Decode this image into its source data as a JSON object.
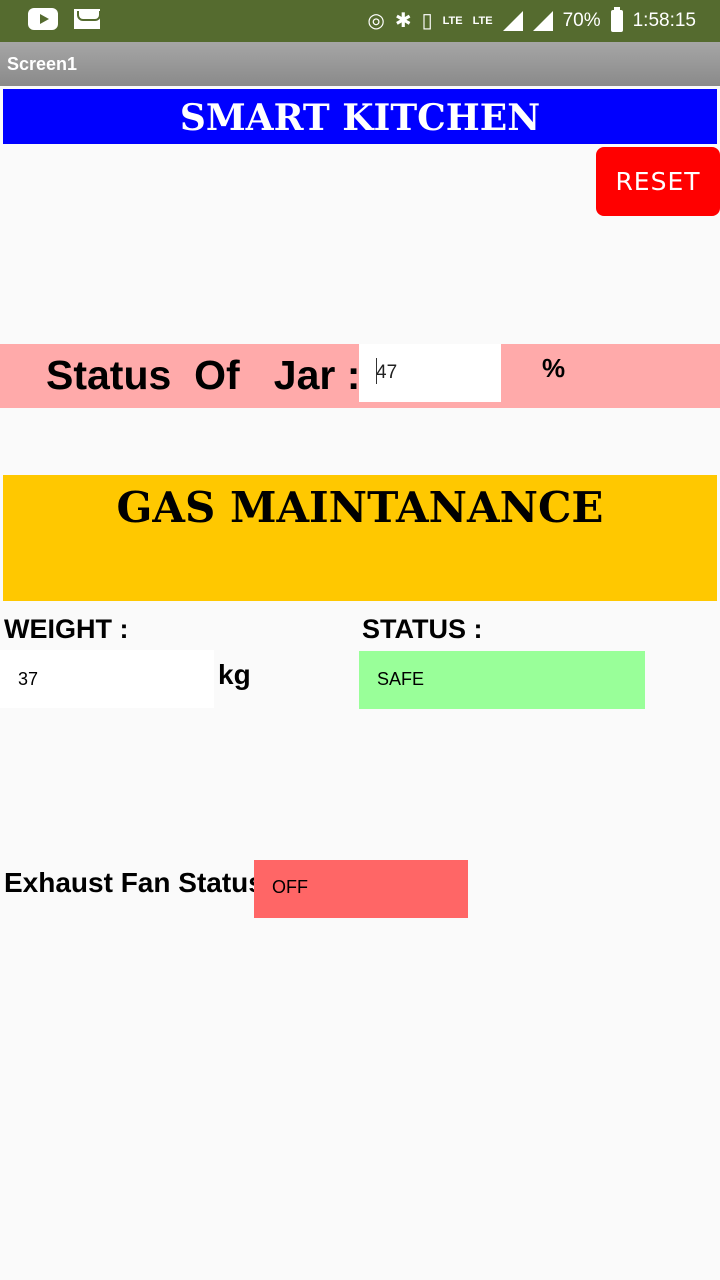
{
  "status_bar": {
    "battery": "70%",
    "time": "1:58:15",
    "lte1": "LTE",
    "lte2": "LTE",
    "icons": [
      "youtube-icon",
      "mail-icon",
      "hotspot-icon",
      "bluetooth-icon",
      "vibrate-icon",
      "call-lte-icon",
      "lte-icon",
      "signal-icon",
      "signal-icon",
      "battery-icon"
    ]
  },
  "window": {
    "title": "Screen1"
  },
  "header": {
    "title": "SMART KITCHEN"
  },
  "reset_button": {
    "label": "RESET"
  },
  "jar": {
    "label": "Status  Of   Jar :",
    "value": "47",
    "unit": "%"
  },
  "gas": {
    "title": "GAS MAINTANANCE",
    "weight_label": "WEIGHT :",
    "weight_value": "37",
    "weight_unit": "kg",
    "status_label": "STATUS :",
    "status_value": "SAFE"
  },
  "exhaust_fan": {
    "label": "Exhaust Fan Status",
    "value": "OFF"
  },
  "colors": {
    "status_bar": "#556b2f",
    "header": "#0000ff",
    "reset": "#ff0000",
    "jar_row": "#ffaaaa",
    "gas_panel": "#ffc800",
    "safe": "#99ff99",
    "off": "#ff6666"
  }
}
